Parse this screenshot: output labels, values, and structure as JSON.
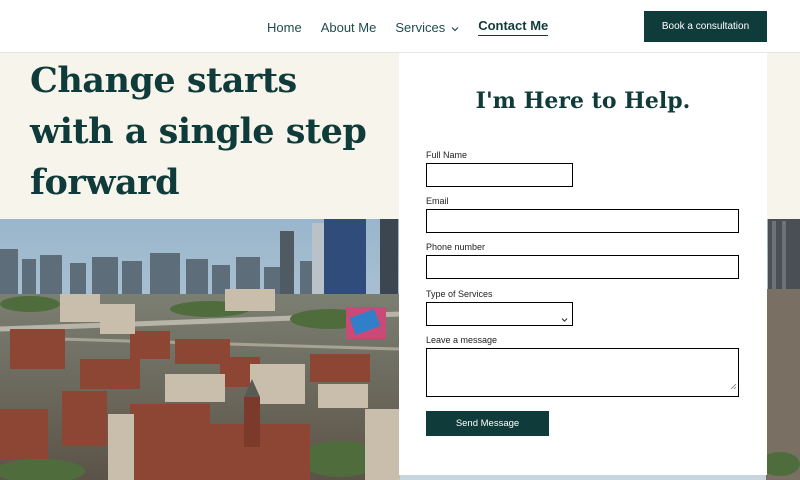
{
  "nav": {
    "items": [
      {
        "label": "Home"
      },
      {
        "label": "About Me"
      },
      {
        "label": "Services"
      },
      {
        "label": "Contact Me"
      }
    ],
    "cta_label": "Book a consultation"
  },
  "hero": {
    "headline": "Change starts with a single step forward"
  },
  "form": {
    "title": "I'm Here to Help.",
    "fields": {
      "name_label": "Full Name",
      "email_label": "Email",
      "phone_label": "Phone number",
      "services_label": "Type of Services",
      "message_label": "Leave a message"
    },
    "submit_label": "Send Message"
  },
  "colors": {
    "brand": "#0f3b3a",
    "hero_bg": "#f7f4ec"
  }
}
